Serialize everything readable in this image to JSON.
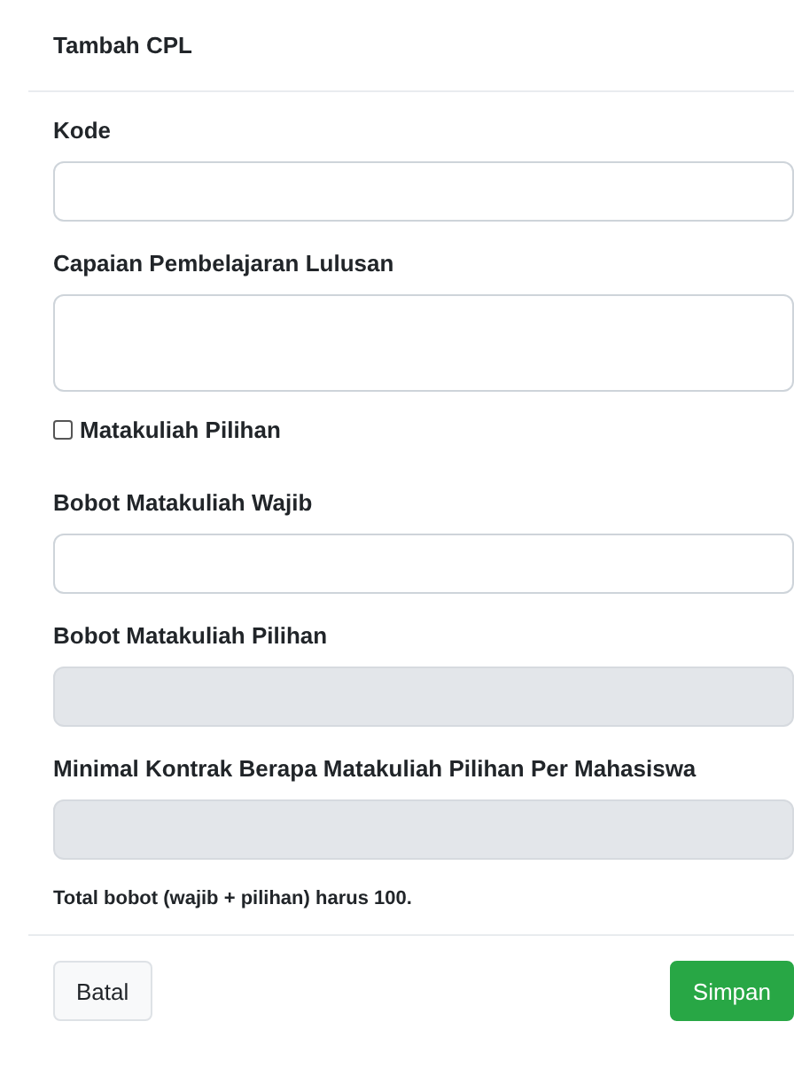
{
  "dialog": {
    "title": "Tambah CPL"
  },
  "fields": [
    {
      "kind": "input",
      "label": "Kode",
      "disabled": false
    },
    {
      "kind": "textarea",
      "label": "Capaian Pembelajaran Lulusan",
      "disabled": false
    },
    {
      "kind": "checkbox",
      "label": "Matakuliah Pilihan",
      "checked": false
    },
    {
      "kind": "input",
      "label": "Bobot Matakuliah Wajib",
      "disabled": false
    },
    {
      "kind": "input",
      "label": "Bobot Matakuliah Pilihan",
      "disabled": true
    },
    {
      "kind": "input",
      "label": "Minimal Kontrak Berapa Matakuliah Pilihan Per Mahasiswa",
      "disabled": true
    }
  ],
  "note": "Total bobot (wajib + pilihan) harus 100.",
  "buttons": [
    {
      "kind": "secondary",
      "label": "Batal"
    },
    {
      "kind": "primary",
      "label": "Simpan"
    }
  ]
}
